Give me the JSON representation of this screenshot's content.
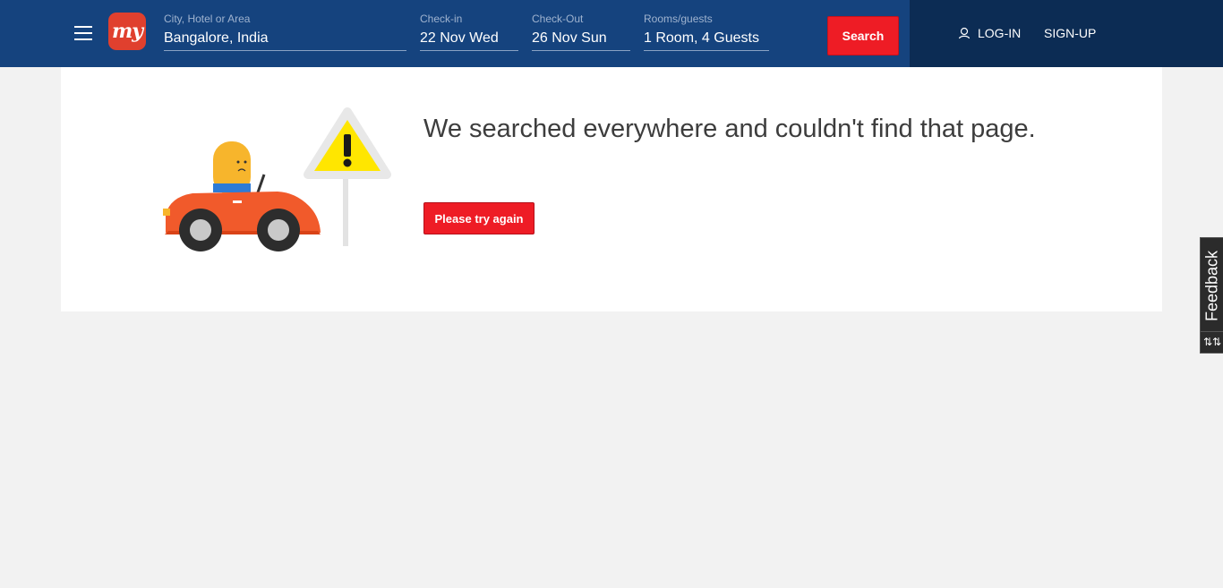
{
  "header": {
    "logo_text": "my",
    "search": {
      "city": {
        "label": "City, Hotel or Area",
        "value": "Bangalore, India"
      },
      "checkin": {
        "label": "Check-in",
        "value": "22 Nov Wed"
      },
      "checkout": {
        "label": "Check-Out",
        "value": "26 Nov Sun"
      },
      "rooms": {
        "label": "Rooms/guests",
        "value": "1 Room, 4 Guests"
      },
      "button": "Search"
    },
    "login": "LOG-IN",
    "signup": "SIGN-UP"
  },
  "error": {
    "title": "We searched everywhere and couldn't find that page.",
    "retry_button": "Please try again"
  },
  "feedback": {
    "label": "Feedback"
  },
  "colors": {
    "header": "#15437e",
    "header_dark": "#0c2c54",
    "accent_red": "#ee1c25",
    "background": "#f2f2f2"
  }
}
